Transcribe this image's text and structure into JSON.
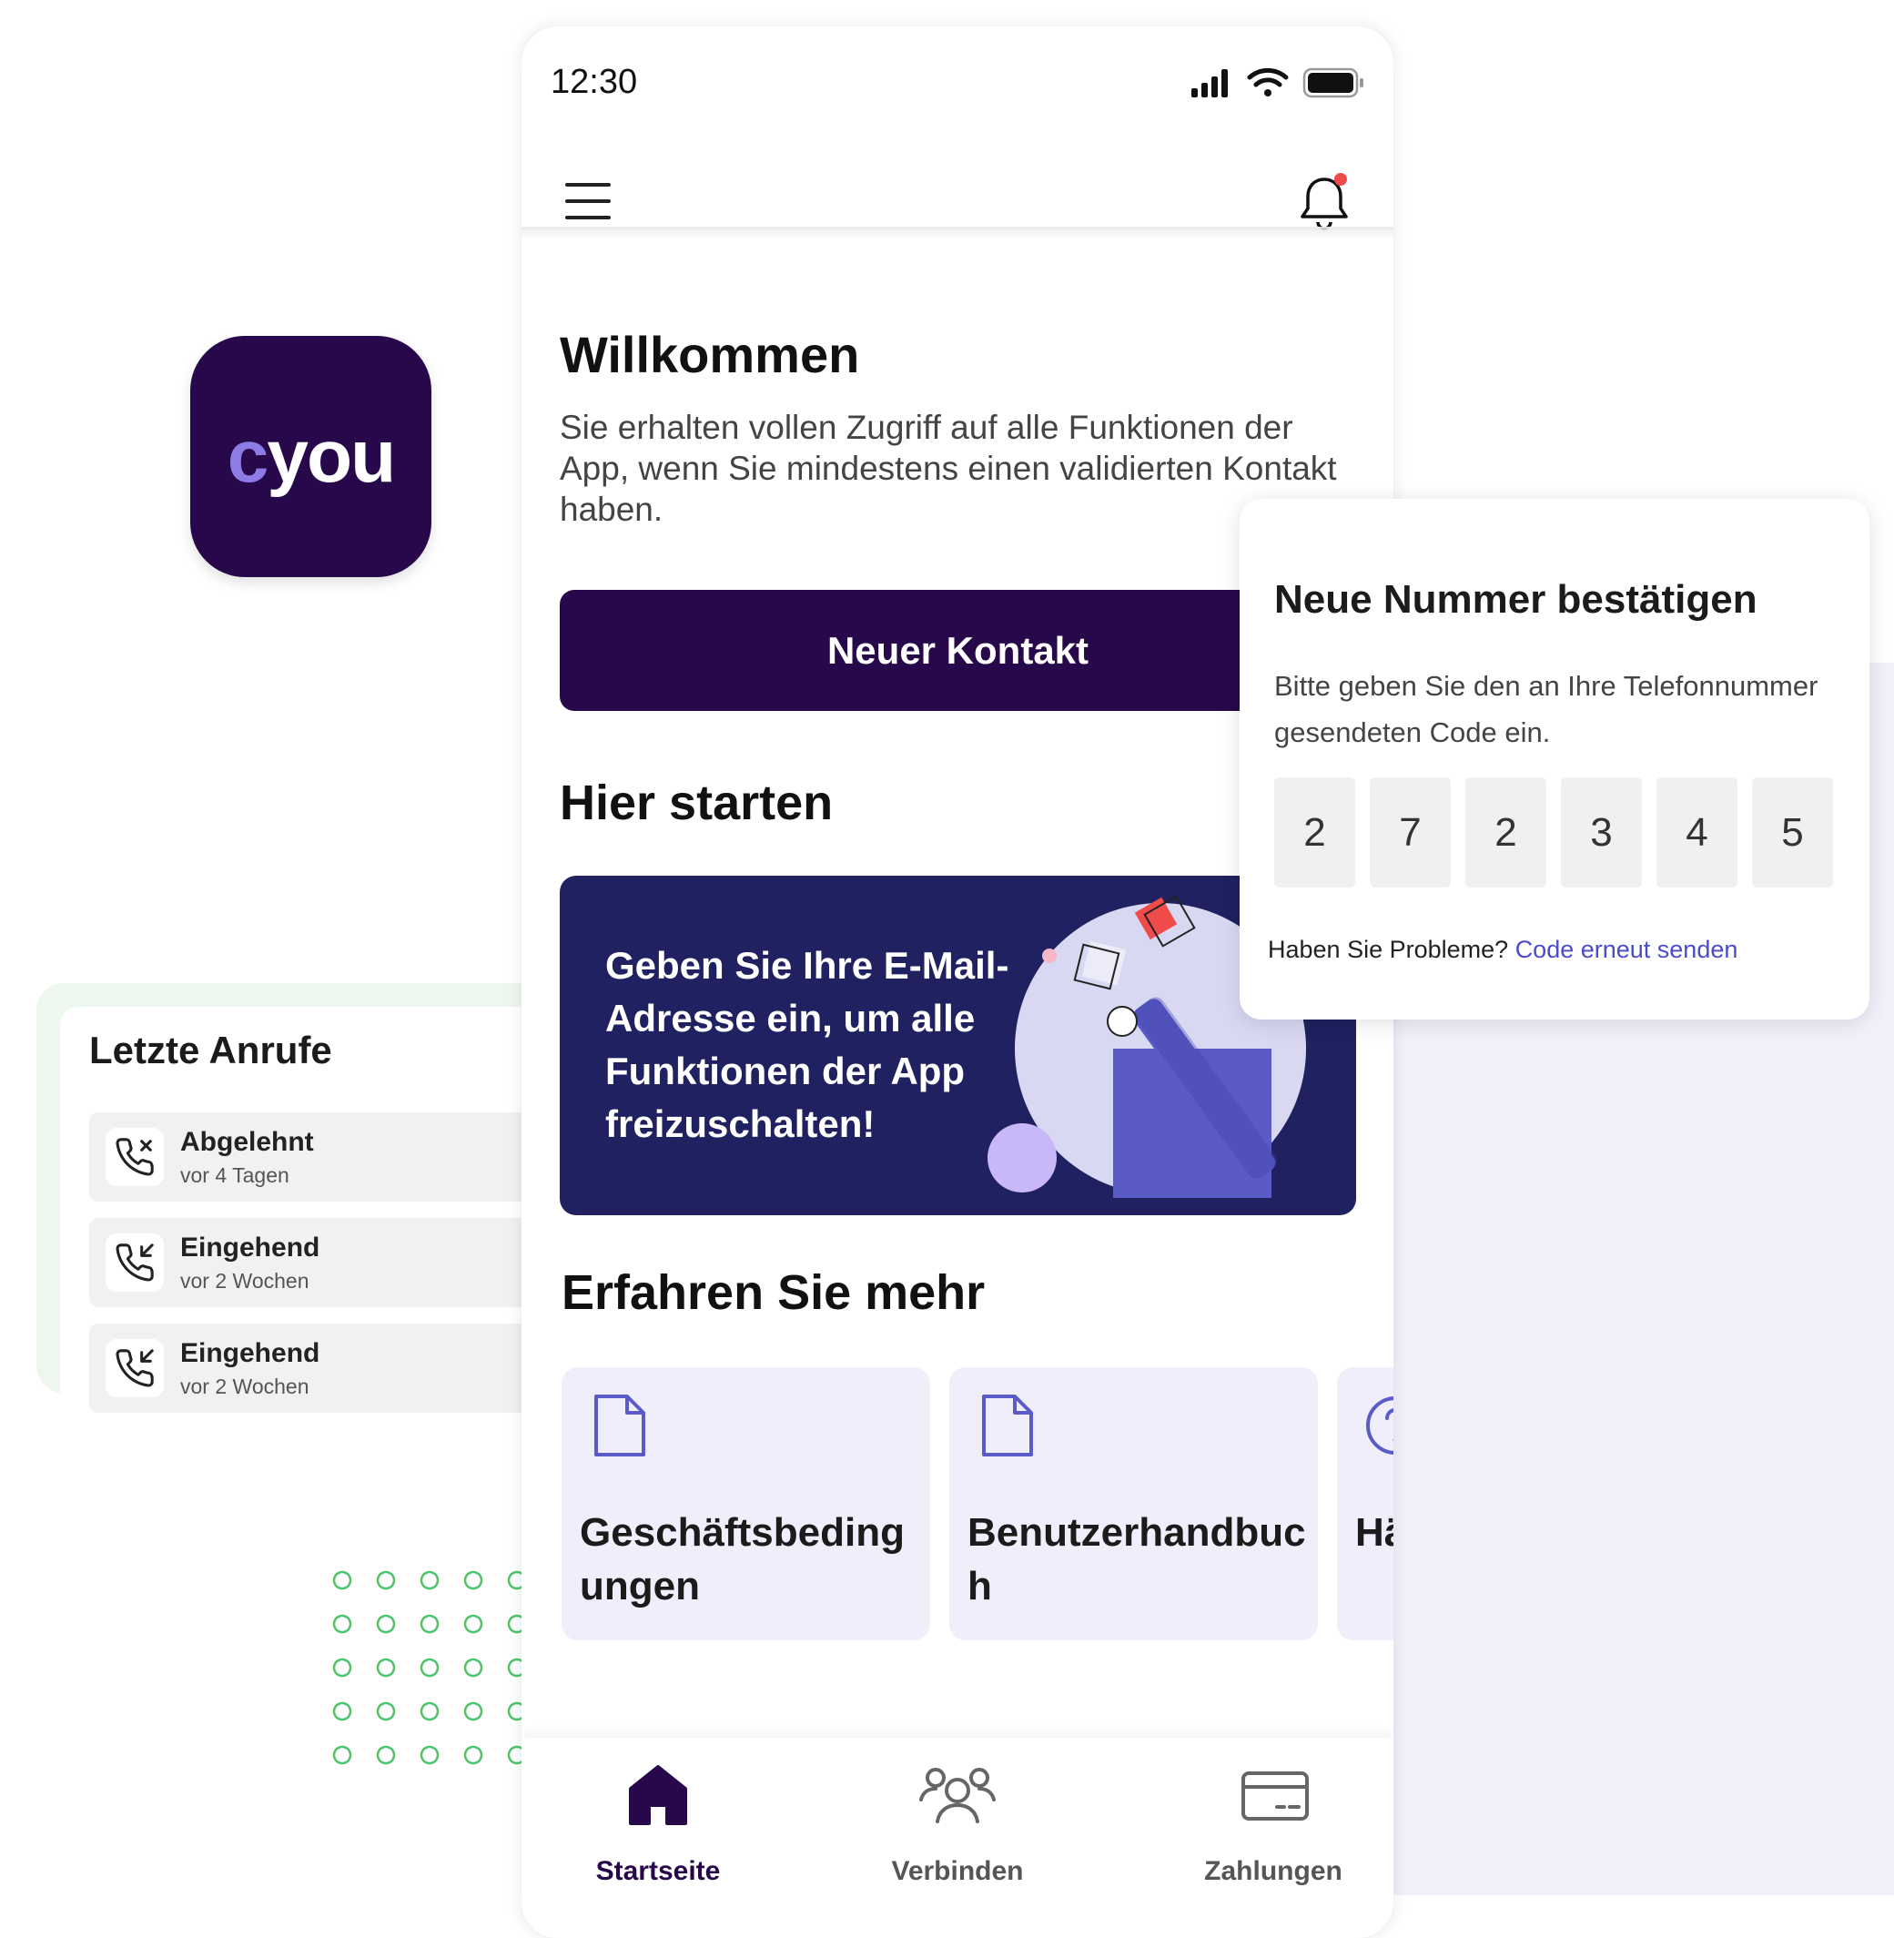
{
  "app_icon": {
    "brand_c": "c",
    "brand_rest": "you"
  },
  "recent_calls": {
    "title": "Letzte Anrufe",
    "items": [
      {
        "type": "missed-call-icon",
        "name": "Abgelehnt",
        "time": "vor 4 Tagen"
      },
      {
        "type": "incoming-call-icon",
        "name": "Eingehend",
        "time": "vor 2 Wochen"
      },
      {
        "type": "incoming-call-icon",
        "name": "Eingehend",
        "time": "vor 2 Wochen"
      }
    ]
  },
  "status_bar": {
    "time": "12:30"
  },
  "main": {
    "welcome_title": "Willkommen",
    "welcome_text": "Sie erhalten vollen Zugriff auf alle Funktionen der App, wenn Sie mindestens einen validierten Kontakt haben.",
    "new_contact_button": "Neuer Kontakt",
    "start_title": "Hier starten",
    "promo_text": "Geben Sie Ihre E-Mail-Adresse ein, um alle Funktionen der App freizuschalten!",
    "learn_title": "Erfahren Sie mehr",
    "learn_cards": [
      {
        "icon": "document-icon",
        "label": "Geschäftsbedingungen"
      },
      {
        "icon": "document-icon",
        "label": "Benutzerhandbuch"
      },
      {
        "icon": "help-circle-icon",
        "label": "Häufige Fragen"
      }
    ]
  },
  "tabbar": {
    "tabs": [
      {
        "icon": "home-icon",
        "label": "Startseite",
        "active": true
      },
      {
        "icon": "users-icon",
        "label": "Verbinden",
        "active": false
      },
      {
        "icon": "credit-card-icon",
        "label": "Zahlungen",
        "active": false
      }
    ]
  },
  "verify": {
    "title": "Neue Nummer bestätigen",
    "text": "Bitte geben Sie den an Ihre Telefonnummer gesendeten Code ein.",
    "code": [
      "2",
      "7",
      "2",
      "3",
      "4",
      "5"
    ],
    "help_text": "Haben Sie Probleme?",
    "resend_link": "Code erneut senden"
  },
  "colors": {
    "brand_dark": "#27084a",
    "promo_bg": "#1f2160",
    "accent": "#5b5bc7",
    "link": "#4b4cc9",
    "card_bg": "#f0eefb",
    "notification_dot": "#f04b4b"
  }
}
